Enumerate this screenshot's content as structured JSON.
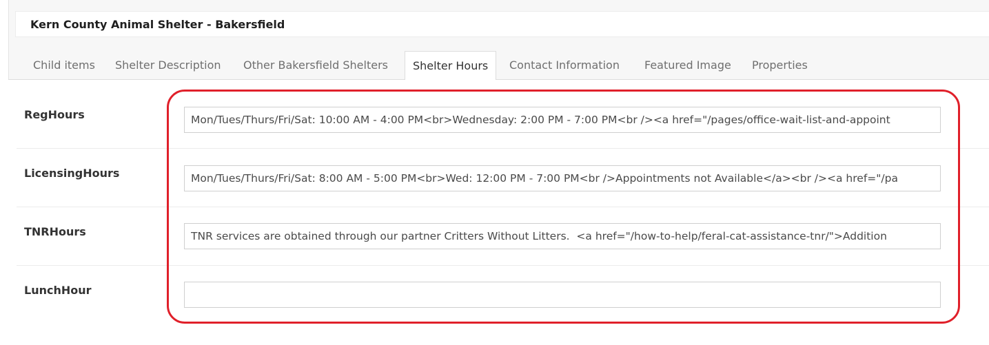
{
  "header": {
    "title": "Kern County Animal Shelter - Bakersfield"
  },
  "tabs": [
    {
      "label": "Child items",
      "active": false
    },
    {
      "label": "Shelter Description",
      "active": false
    },
    {
      "label": "Other Bakersfield Shelters",
      "active": false
    },
    {
      "label": "Shelter Hours",
      "active": true
    },
    {
      "label": "Contact Information",
      "active": false
    },
    {
      "label": "Featured Image",
      "active": false
    },
    {
      "label": "Properties",
      "active": false
    }
  ],
  "fields": [
    {
      "label": "RegHours",
      "value": "Mon/Tues/Thurs/Fri/Sat: 10:00 AM - 4:00 PM<br>Wednesday: 2:00 PM - 7:00 PM<br /><a href=\"/pages/office-wait-list-and-appoint"
    },
    {
      "label": "LicensingHours",
      "value": "Mon/Tues/Thurs/Fri/Sat: 8:00 AM - 5:00 PM<br>Wed: 12:00 PM - 7:00 PM<br />Appointments not Available</a><br /><a href=\"/pa"
    },
    {
      "label": "TNRHours",
      "value": "TNR services are obtained through our partner Critters Without Litters.  <a href=\"/how-to-help/feral-cat-assistance-tnr/\">Addition"
    },
    {
      "label": "LunchHour",
      "value": ""
    }
  ],
  "colors": {
    "highlight": "#e0202a",
    "tab_border": "#dcdcdc",
    "background": "#f7f7f7"
  }
}
